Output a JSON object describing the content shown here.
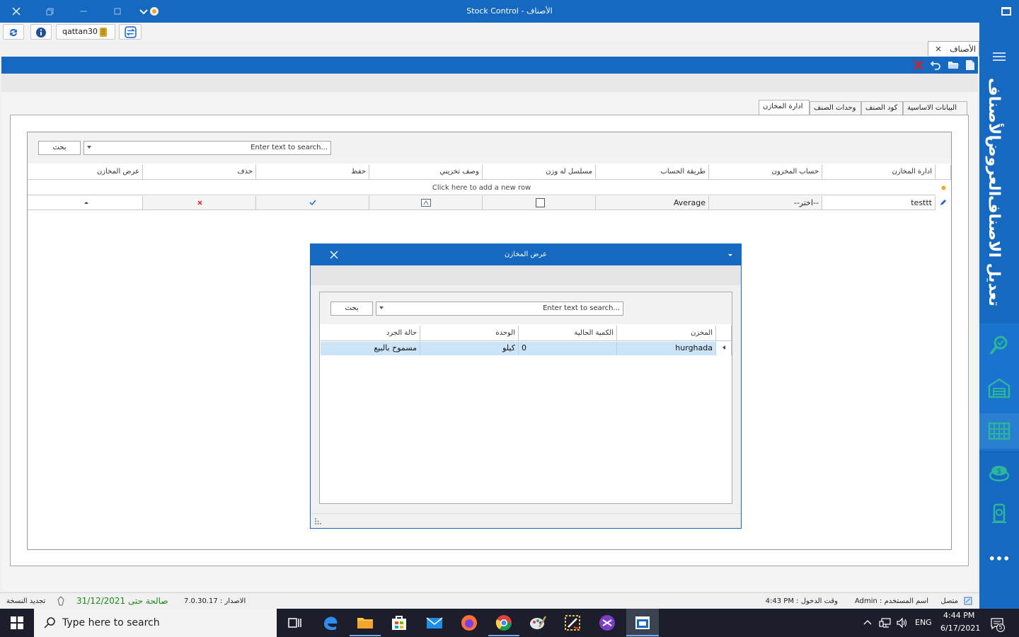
{
  "window": {
    "title": "Stock Control - الأصناف"
  },
  "toolbar": {
    "user": "qattan30"
  },
  "doc_tab": {
    "label": "الأصناف"
  },
  "sidebar": {
    "labels": [
      "الأصناف",
      "العروض",
      "تعديل الاصناف"
    ],
    "more": "•••"
  },
  "tabs": [
    {
      "label": "البيانات الاساسية"
    },
    {
      "label": "كود الصنف"
    },
    {
      "label": "وحدات الصنف"
    },
    {
      "label": "ادارة المخازن"
    }
  ],
  "grid": {
    "search_button": "بحث",
    "search_placeholder": "Enter text to search...",
    "columns": [
      "ادارة المخازن",
      "حساب المخزون",
      "طريقة الحساب",
      "مسلسل له وزن",
      "وصف تخزيني",
      "حفظ",
      "حذف",
      "عرض المخازن"
    ],
    "new_row_text": "Click here to add a new row",
    "rows": [
      {
        "name": "testtt",
        "account": "--اختر--",
        "method": "Average",
        "serial": false
      }
    ]
  },
  "dialog": {
    "title": "عرض المخازن",
    "search_button": "بحث",
    "search_placeholder": "Enter text to search...",
    "columns": [
      "المخزن",
      "الكمية الحالية",
      "الوحدة",
      "حالة الجرد"
    ],
    "rows": [
      {
        "store": "hurghada",
        "qty": "0",
        "unit": "كيلو",
        "status": "مسموح بالبيع"
      }
    ]
  },
  "status": {
    "connected": "متصل",
    "user": "Admin : اسم المستخدم",
    "login_time": "4:43 PM : وقت الدخول",
    "version": "الاصدار : 7.0.30.17",
    "valid_until": "صالحة حتى 31/12/2021",
    "renew": "تجديد النسخة"
  },
  "taskbar": {
    "search_placeholder": "Type here to search",
    "lang": "ENG",
    "time": "4:44 PM",
    "date": "6/17/2021",
    "notifications": "5"
  },
  "colors": {
    "accent": "#1669c1",
    "selection": "#cce4f7",
    "valid": "#1a8a1a"
  }
}
